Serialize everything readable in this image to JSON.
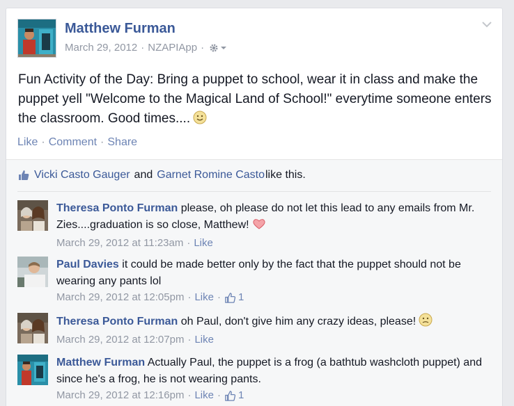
{
  "post": {
    "author": "Matthew Furman",
    "date": "March 29, 2012",
    "separator": "·",
    "app": "NZAPIApp",
    "text": "Fun Activity of the Day: Bring a puppet to school, wear it in class and make the puppet yell \"Welcome to the Magical Land of School!\" everytime someone enters the classroom. Good times....",
    "actions": {
      "like": "Like",
      "comment": "Comment",
      "share": "Share"
    }
  },
  "likes": {
    "name1": "Vicki Casto Gauger",
    "and": "and",
    "name2": "Garnet Romine Casto",
    "suffix": "like this."
  },
  "comments": [
    {
      "name": "Theresa Ponto Furman",
      "text": "please, oh please do not let this lead to any emails from Mr. Zies....graduation is so close, Matthew!",
      "time": "March 29, 2012 at 11:23am",
      "like": "Like",
      "likes": ""
    },
    {
      "name": "Paul Davies",
      "text": "it could be made better only by the fact that the puppet should not be wearing any pants lol",
      "time": "March 29, 2012 at 12:05pm",
      "like": "Like",
      "likes": "1"
    },
    {
      "name": "Theresa Ponto Furman",
      "text": "oh Paul, don't give him any crazy ideas, please!",
      "time": "March 29, 2012 at 12:07pm",
      "like": "Like",
      "likes": ""
    },
    {
      "name": "Matthew Furman",
      "text": "Actually Paul, the puppet is a frog (a bathtub washcloth puppet) and since he's a frog, he is not wearing pants.",
      "time": "March 29, 2012 at 12:16pm",
      "like": "Like",
      "likes": "1"
    }
  ],
  "colors": {
    "link": "#3b5998",
    "action": "#6d84b4",
    "meta": "#9197a3",
    "ufi_bg": "#f6f7f8",
    "page_bg": "#e9eaed"
  },
  "icons": {
    "gear": "gear-icon",
    "dropdown": "chevron-down-icon",
    "thumb": "thumbs-up-icon",
    "smiley": "smiley-emoticon-icon",
    "heart": "heart-emoticon-icon"
  }
}
